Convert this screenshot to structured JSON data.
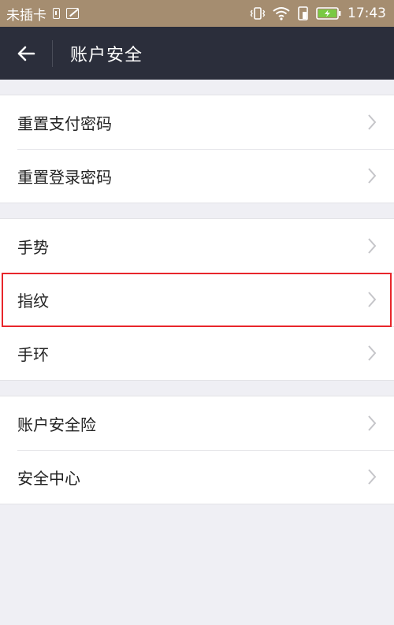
{
  "status_bar": {
    "carrier": "未插卡",
    "time": "17:43"
  },
  "header": {
    "title": "账户安全"
  },
  "groups": [
    {
      "items": [
        {
          "label": "重置支付密码"
        },
        {
          "label": "重置登录密码"
        }
      ]
    },
    {
      "items": [
        {
          "label": "手势"
        },
        {
          "label": "指纹"
        },
        {
          "label": "手环"
        }
      ]
    },
    {
      "items": [
        {
          "label": "账户安全险"
        },
        {
          "label": "安全中心"
        }
      ]
    }
  ],
  "colors": {
    "status_bar": "#a58d70",
    "header": "#2b2e3b",
    "highlight": "#e8262b"
  }
}
